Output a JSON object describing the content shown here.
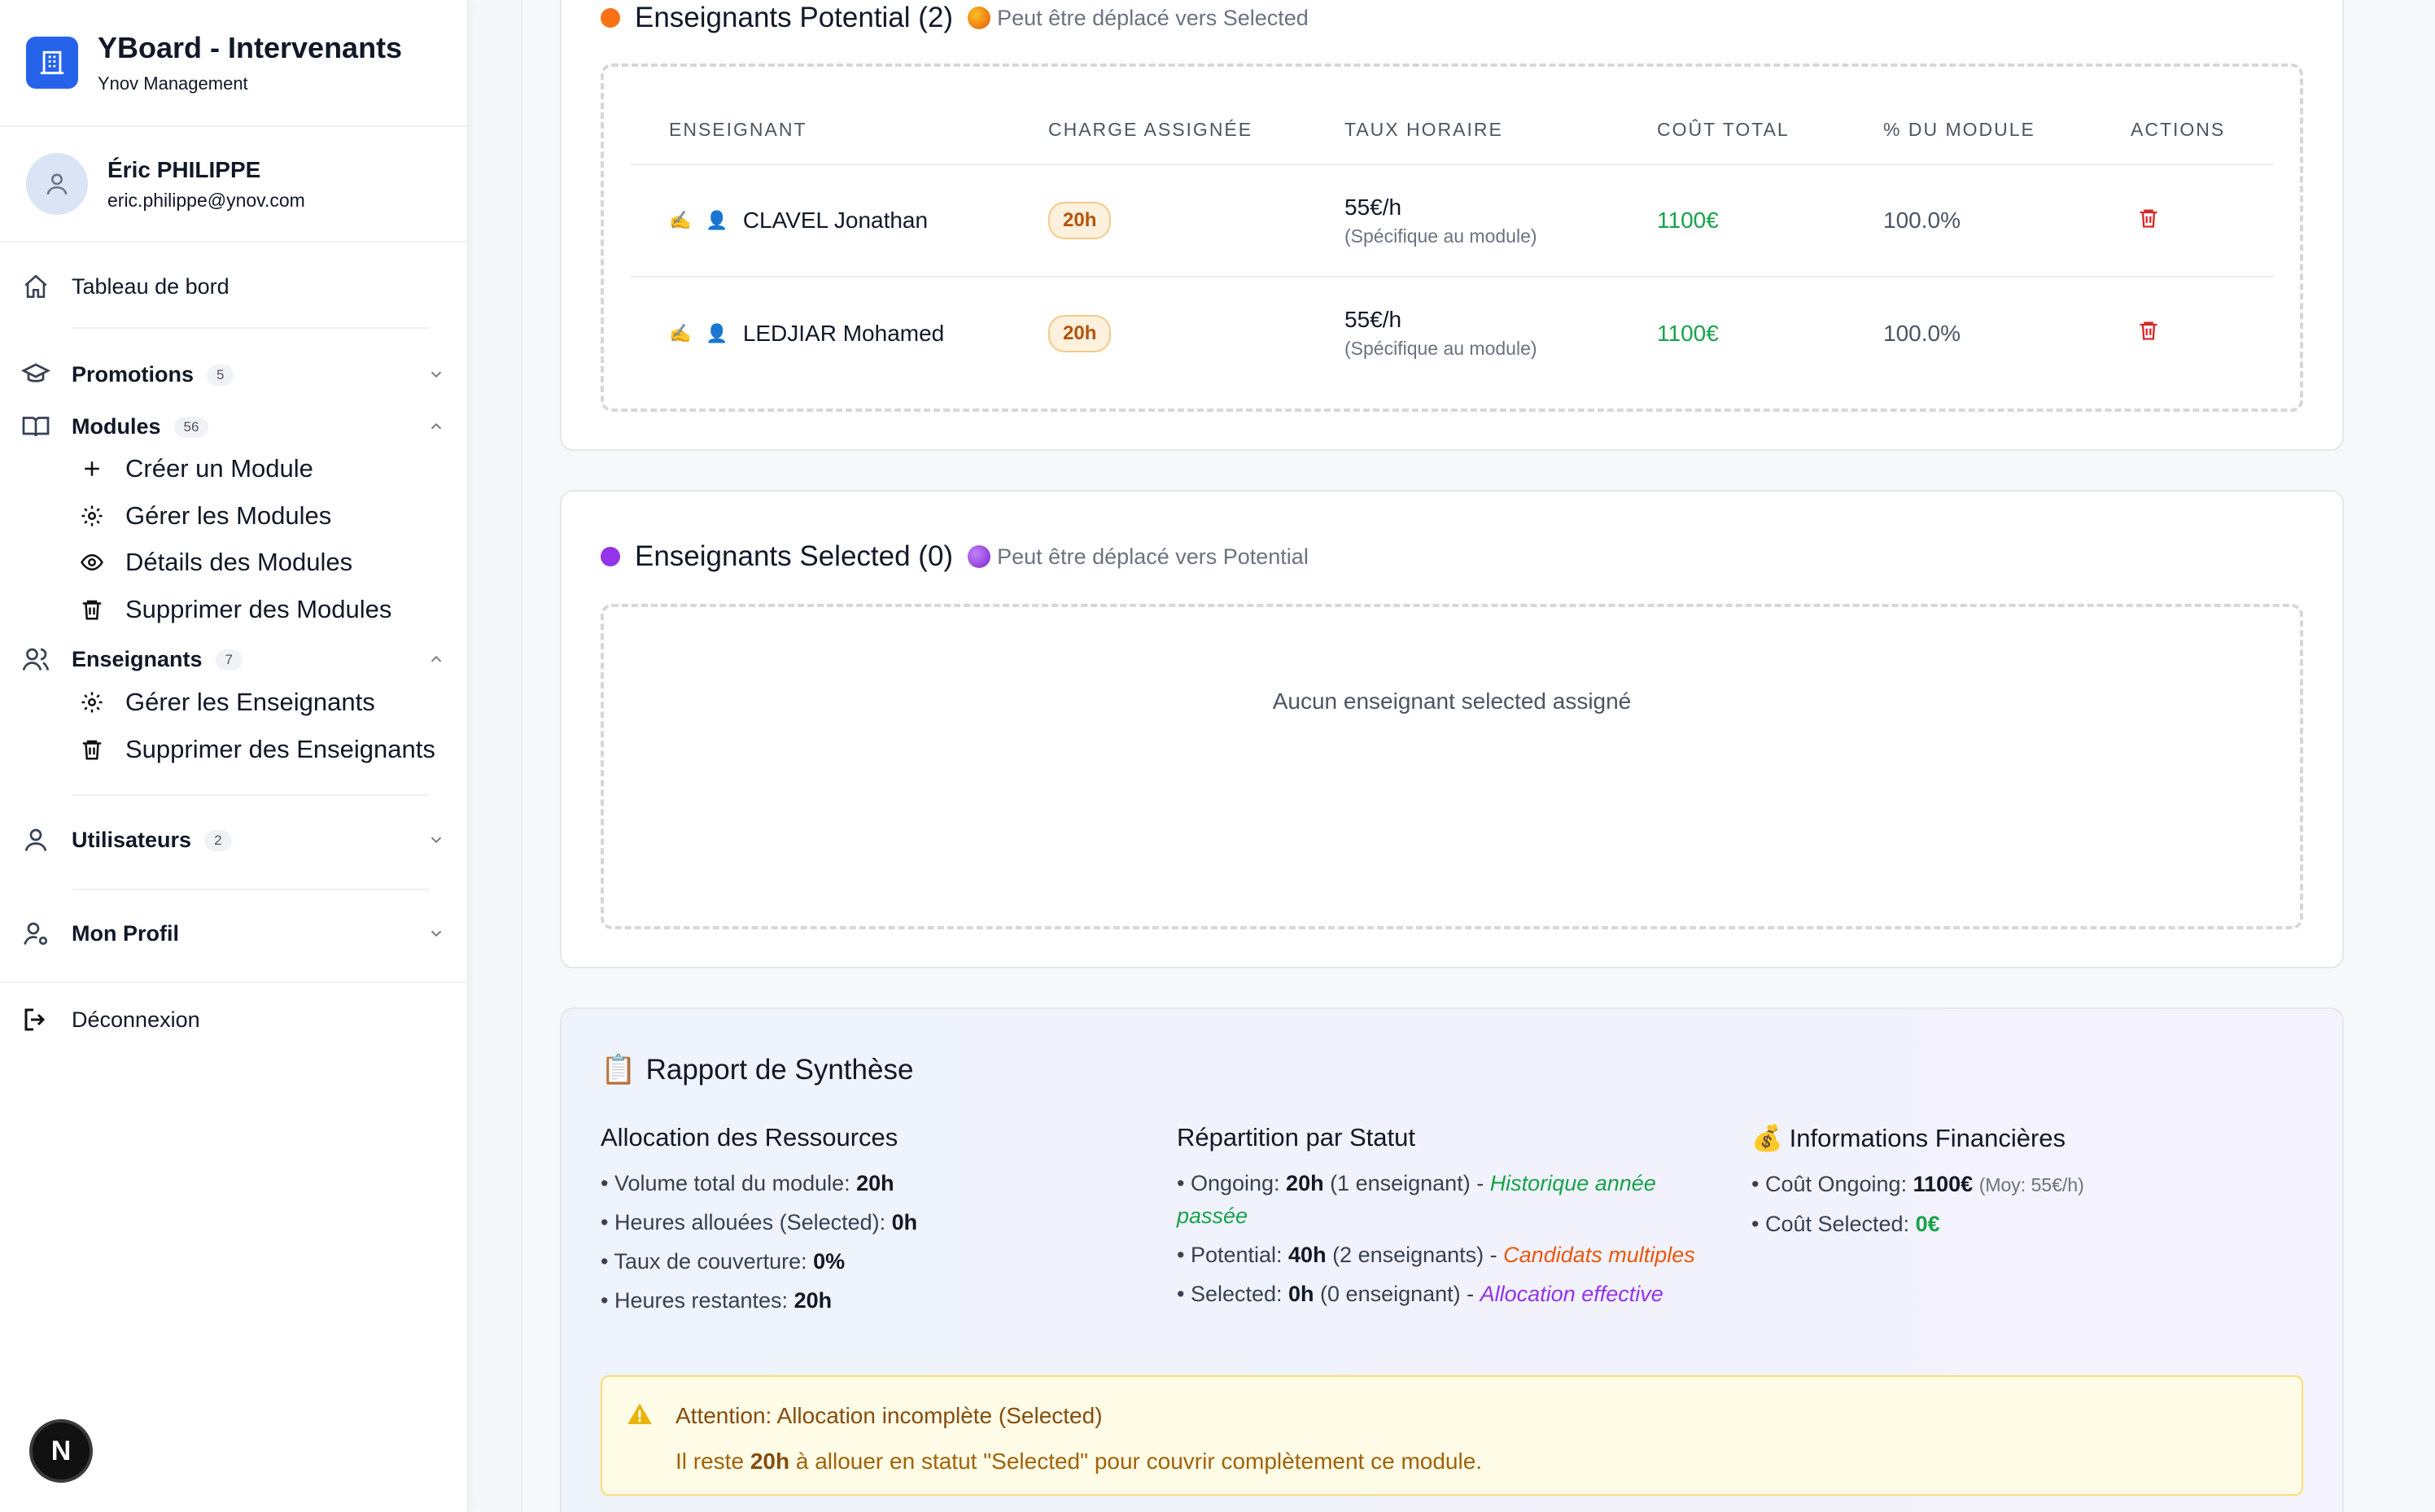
{
  "app": {
    "title": "YBoard - Intervenants",
    "subtitle": "Ynov Management"
  },
  "user": {
    "name": "Éric PHILIPPE",
    "email": "eric.philippe@ynov.com"
  },
  "sidebar": {
    "dashboard": "Tableau de bord",
    "promotions": {
      "label": "Promotions",
      "count": "5"
    },
    "modules": {
      "label": "Modules",
      "count": "56",
      "items": [
        "Créer un Module",
        "Gérer les Modules",
        "Détails des Modules",
        "Supprimer des Modules"
      ]
    },
    "teachers": {
      "label": "Enseignants",
      "count": "7",
      "items": [
        "Gérer les Enseignants",
        "Supprimer des Enseignants"
      ]
    },
    "users": {
      "label": "Utilisateurs",
      "count": "2"
    },
    "profile": {
      "label": "Mon Profil"
    },
    "logout": "Déconnexion"
  },
  "potential": {
    "title": "Enseignants Potential (2)",
    "hint": "Peut être déplacé vers Selected",
    "color": "#f97316",
    "headers": [
      "ENSEIGNANT",
      "CHARGE ASSIGNÉE",
      "TAUX HORAIRE",
      "COÛT TOTAL",
      "% DU MODULE",
      "ACTIONS"
    ],
    "rows": [
      {
        "name": "CLAVEL Jonathan",
        "charge": "20h",
        "rate": "55€/h",
        "rate_note": "(Spécifique au module)",
        "cost": "1100€",
        "pct": "100.0%"
      },
      {
        "name": "LEDJIAR Mohamed",
        "charge": "20h",
        "rate": "55€/h",
        "rate_note": "(Spécifique au module)",
        "cost": "1100€",
        "pct": "100.0%"
      }
    ]
  },
  "selected": {
    "title": "Enseignants Selected (0)",
    "hint": "Peut être déplacé vers Potential",
    "color": "#9333ea",
    "empty": "Aucun enseignant selected assigné"
  },
  "report": {
    "title": "Rapport de Synthèse",
    "allocation": {
      "heading": "Allocation des Ressources",
      "lines": [
        {
          "label": "• Volume total du module: ",
          "value": "20h"
        },
        {
          "label": "• Heures allouées (Selected): ",
          "value": "0h"
        },
        {
          "label": "• Taux de couverture: ",
          "value": "0%"
        },
        {
          "label": "• Heures restantes: ",
          "value": "20h"
        }
      ]
    },
    "status": {
      "heading": "Répartition par Statut",
      "ongoing": {
        "label": "• Ongoing: ",
        "value": "20h",
        "detail": " (1 enseignant) - ",
        "note": "Historique année passée"
      },
      "potential": {
        "label": "• Potential: ",
        "value": "40h",
        "detail": " (2 enseignants) - ",
        "note": "Candidats multiples"
      },
      "selected": {
        "label": "• Selected: ",
        "value": "0h",
        "detail": " (0 enseignant) - ",
        "note": "Allocation effective"
      }
    },
    "finance": {
      "heading": "Informations Financières",
      "ongoing": {
        "label": "• Coût Ongoing: ",
        "value": "1100€",
        "note": "(Moy: 55€/h)"
      },
      "selected": {
        "label": "• Coût Selected: ",
        "value": "0€"
      }
    },
    "alert": {
      "title": "Attention: Allocation incomplète (Selected)",
      "text_before": "Il reste ",
      "hours": "20h",
      "text_after": " à allouer en statut \"Selected\" pour couvrir complètement ce module."
    }
  },
  "next_badge": "N"
}
